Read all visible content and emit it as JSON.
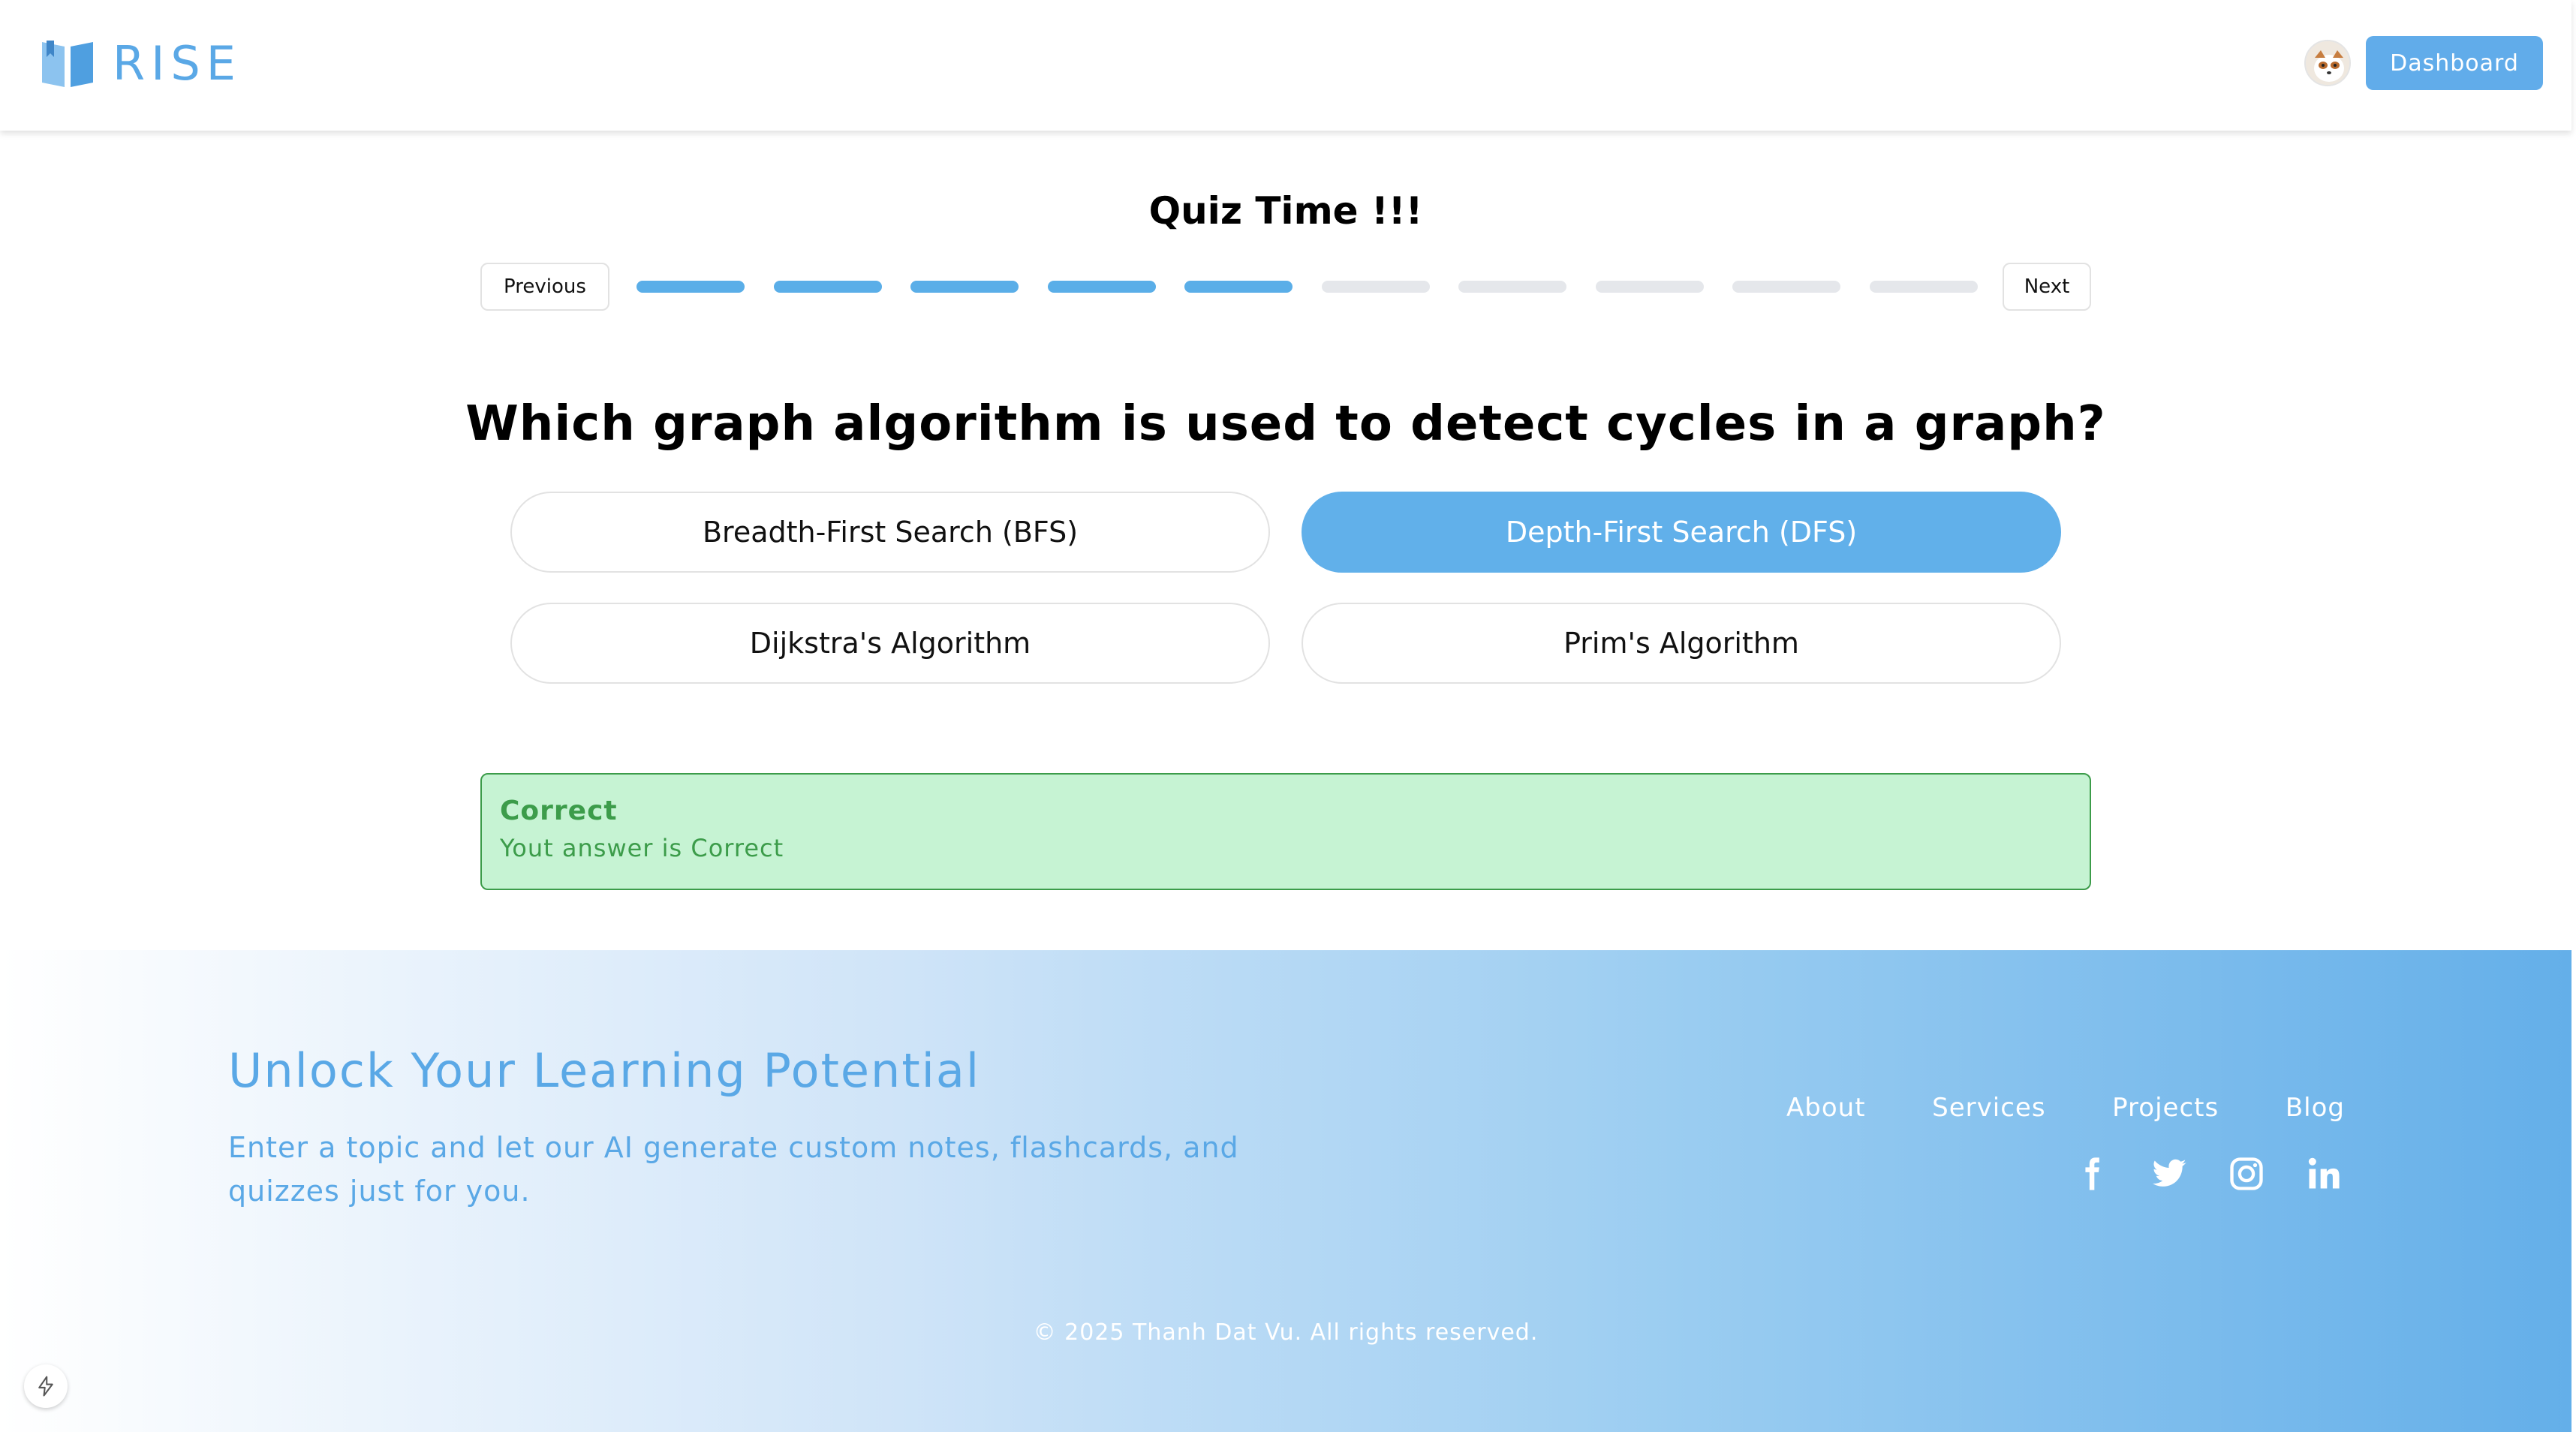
{
  "header": {
    "logo_text": "RISE",
    "dashboard_label": "Dashboard"
  },
  "quiz": {
    "title": "Quiz Time !!!",
    "previous_label": "Previous",
    "next_label": "Next",
    "progress": {
      "total_segments": 10,
      "completed_segments": 5,
      "active_color": "#5aaee8",
      "inactive_color": "#e5e7eb"
    },
    "question": "Which graph algorithm is used to detect cycles in a graph?",
    "options": [
      {
        "label": "Breadth-First Search (BFS)",
        "selected": false
      },
      {
        "label": "Depth-First Search (DFS)",
        "selected": true
      },
      {
        "label": "Dijkstra's Algorithm",
        "selected": false
      },
      {
        "label": "Prim's Algorithm",
        "selected": false
      }
    ],
    "result": {
      "title": "Correct",
      "message": "Yout answer is Correct"
    }
  },
  "footer": {
    "title": "Unlock Your Learning Potential",
    "description": "Enter a topic and let our AI generate custom notes, flashcards, and quizzes just for you.",
    "links": [
      "About",
      "Services",
      "Projects",
      "Blog"
    ],
    "socials": [
      "facebook-icon",
      "twitter-icon",
      "instagram-icon",
      "linkedin-icon"
    ],
    "copyright": "© 2025 Thanh Dat Vu. All rights reserved."
  },
  "colors": {
    "brand": "#5aa8e6",
    "selected_option": "#61b0ea",
    "success_bg": "#c6f3d3",
    "success_text": "#3c9c4a"
  }
}
